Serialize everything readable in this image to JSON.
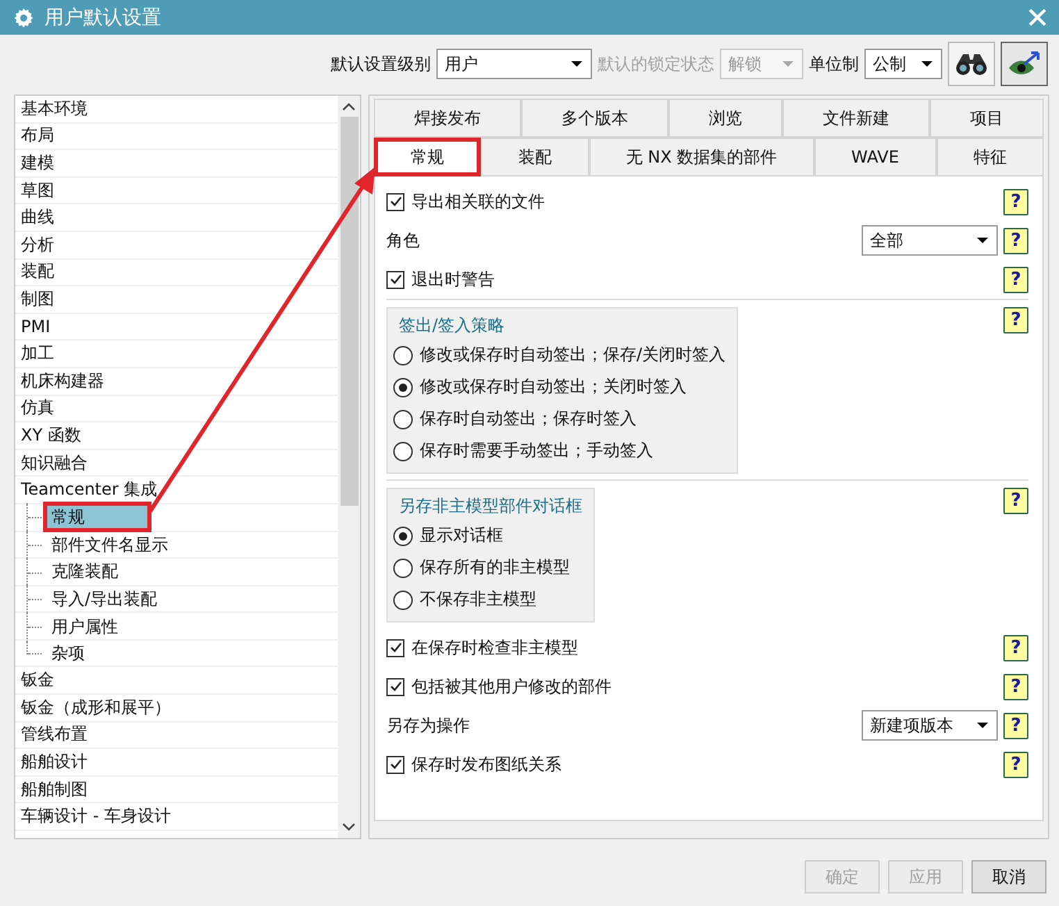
{
  "window": {
    "title": "用户默认设置"
  },
  "toolbar": {
    "level_label": "默认设置级别",
    "level_value": "用户",
    "lock_label": "默认的锁定状态",
    "lock_value": "解锁",
    "lock_disabled": true,
    "units_label": "单位制",
    "units_value": "公制"
  },
  "tree": [
    {
      "label": "基本环境"
    },
    {
      "label": "布局"
    },
    {
      "label": "建模"
    },
    {
      "label": "草图"
    },
    {
      "label": "曲线"
    },
    {
      "label": "分析"
    },
    {
      "label": "装配"
    },
    {
      "label": "制图"
    },
    {
      "label": "PMI"
    },
    {
      "label": "加工"
    },
    {
      "label": "机床构建器"
    },
    {
      "label": "仿真"
    },
    {
      "label": "XY 函数"
    },
    {
      "label": "知识融合"
    },
    {
      "label": "Teamcenter 集成",
      "children": [
        {
          "label": "常规",
          "selected": true,
          "highlighted": true
        },
        {
          "label": "部件文件名显示",
          "selected": false,
          "highlighted": false
        },
        {
          "label": "克隆装配",
          "selected": false,
          "highlighted": false
        },
        {
          "label": "导入/导出装配",
          "selected": false,
          "highlighted": false
        },
        {
          "label": "用户属性",
          "selected": false,
          "highlighted": false
        },
        {
          "label": "杂项",
          "selected": false,
          "highlighted": false
        }
      ]
    },
    {
      "label": "钣金"
    },
    {
      "label": "钣金（成形和展平）"
    },
    {
      "label": "管线布置"
    },
    {
      "label": "船舶设计"
    },
    {
      "label": "船舶制图"
    },
    {
      "label": "车辆设计 - 车身设计"
    }
  ],
  "tab_rows": [
    [
      {
        "label": "焊接发布",
        "selected": false,
        "highlighted": false
      },
      {
        "label": "多个版本",
        "selected": false,
        "highlighted": false
      },
      {
        "label": "浏览",
        "selected": false,
        "highlighted": false
      },
      {
        "label": "文件新建",
        "selected": false,
        "highlighted": false
      },
      {
        "label": "项目",
        "selected": false,
        "highlighted": false
      }
    ],
    [
      {
        "label": "常规",
        "selected": true,
        "highlighted": true
      },
      {
        "label": "装配",
        "selected": false,
        "highlighted": false
      },
      {
        "label": "无 NX 数据集的部件",
        "selected": false,
        "highlighted": false
      },
      {
        "label": "WAVE",
        "selected": false,
        "highlighted": false
      },
      {
        "label": "特征",
        "selected": false,
        "highlighted": false
      }
    ]
  ],
  "settings": [
    {
      "kind": "checkbox",
      "label": "导出相关联的文件",
      "checked": true,
      "help": "?"
    },
    {
      "kind": "dropdown",
      "label": "角色",
      "value": "全部",
      "help": "?"
    },
    {
      "kind": "checkbox",
      "label": "退出时警告",
      "checked": true,
      "help": "?"
    },
    {
      "kind": "radio_group",
      "title": "签出/签入策略",
      "help": "?",
      "options": [
        {
          "label": "修改或保存时自动签出；保存/关闭时签入",
          "selected": false
        },
        {
          "label": "修改或保存时自动签出；关闭时签入",
          "selected": true
        },
        {
          "label": "保存时自动签出；保存时签入",
          "selected": false
        },
        {
          "label": "保存时需要手动签出；手动签入",
          "selected": false
        }
      ]
    },
    {
      "kind": "radio_group",
      "title": "另存非主模型部件对话框",
      "help": "?",
      "options": [
        {
          "label": "显示对话框",
          "selected": true
        },
        {
          "label": "保存所有的非主模型",
          "selected": false
        },
        {
          "label": "不保存非主模型",
          "selected": false
        }
      ]
    },
    {
      "kind": "checkbox",
      "label": "在保存时检查非主模型",
      "checked": true,
      "help": "?"
    },
    {
      "kind": "checkbox",
      "label": "包括被其他用户修改的部件",
      "checked": true,
      "help": "?"
    },
    {
      "kind": "dropdown",
      "label": "另存为操作",
      "value": "新建项版本",
      "help": "?"
    },
    {
      "kind": "checkbox",
      "label": "保存时发布图纸关系",
      "checked": true,
      "help": "?"
    }
  ],
  "buttons": [
    {
      "label": "确定",
      "disabled": true
    },
    {
      "label": "应用",
      "disabled": true
    },
    {
      "label": "取消",
      "disabled": false
    }
  ],
  "annotation": {
    "arrow": true,
    "color": "#e0262b"
  }
}
